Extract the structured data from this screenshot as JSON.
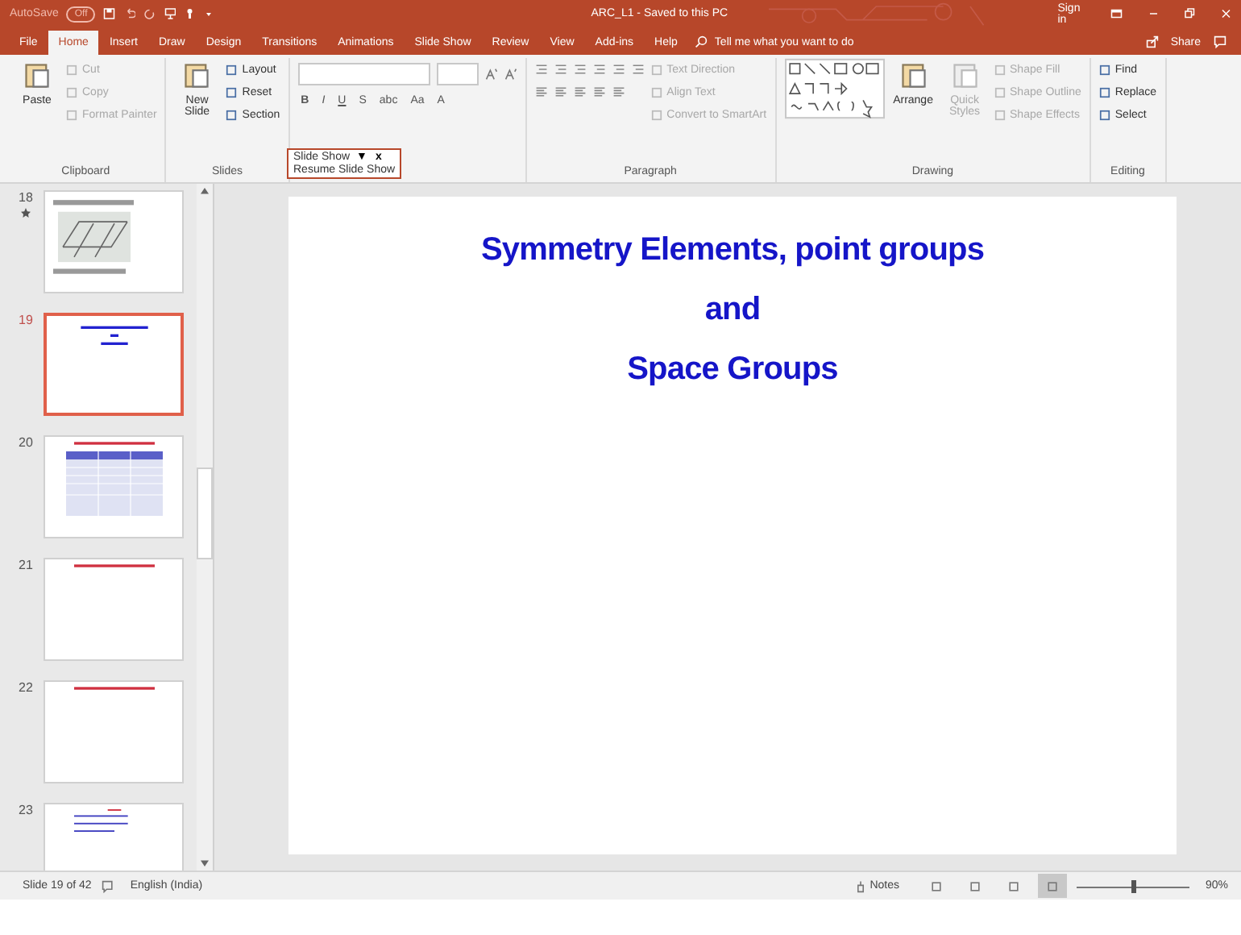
{
  "title_bar": {
    "autosave_label": "AutoSave",
    "autosave_state": "Off",
    "title": "ARC_L1  -  Saved to this PC",
    "sign_in": "Sign in"
  },
  "tabs": [
    {
      "label": "File",
      "selected": false
    },
    {
      "label": "Home",
      "selected": true
    },
    {
      "label": "Insert",
      "selected": false
    },
    {
      "label": "Draw",
      "selected": false
    },
    {
      "label": "Design",
      "selected": false
    },
    {
      "label": "Transitions",
      "selected": false
    },
    {
      "label": "Animations",
      "selected": false
    },
    {
      "label": "Slide Show",
      "selected": false
    },
    {
      "label": "Review",
      "selected": false
    },
    {
      "label": "View",
      "selected": false
    },
    {
      "label": "Add-ins",
      "selected": false
    },
    {
      "label": "Help",
      "selected": false
    }
  ],
  "tell_me": {
    "placeholder": "Tell me what you want to do"
  },
  "share": "Share",
  "ribbon": [
    {
      "kind": "commands",
      "label": "Clipboard",
      "large": [
        {
          "label": "Paste",
          "disabled": false
        }
      ],
      "small": [
        {
          "label": "Cut",
          "disabled": true
        },
        {
          "label": "Copy",
          "disabled": true
        },
        {
          "label": "Format Painter",
          "disabled": true
        }
      ]
    },
    {
      "kind": "commands",
      "label": "Slides",
      "large": [
        {
          "label": "New Slide",
          "disabled": false
        }
      ],
      "small": [
        {
          "label": "Layout",
          "disabled": false
        },
        {
          "label": "Reset",
          "disabled": false
        },
        {
          "label": "Section",
          "disabled": false
        }
      ]
    },
    {
      "kind": "font",
      "buttons": [
        "B",
        "I",
        "U",
        "S",
        "abc",
        "Aa",
        "A"
      ]
    },
    {
      "kind": "paragraph",
      "label": "Paragraph",
      "small": [
        {
          "label": "Text Direction",
          "disabled": true
        },
        {
          "label": "Align Text",
          "disabled": true
        },
        {
          "label": "Convert to SmartArt",
          "disabled": true
        }
      ]
    },
    {
      "kind": "drawing",
      "label": "Drawing",
      "large": [
        {
          "label": "Arrange",
          "disabled": false
        },
        {
          "label": "Quick Styles",
          "disabled": true
        }
      ],
      "small": [
        {
          "label": "Shape Fill",
          "disabled": true
        },
        {
          "label": "Shape Outline",
          "disabled": true
        },
        {
          "label": "Shape Effects",
          "disabled": true
        }
      ]
    },
    {
      "kind": "commands",
      "label": "Editing",
      "small": [
        {
          "label": "Find",
          "disabled": false
        },
        {
          "label": "Replace",
          "disabled": false
        },
        {
          "label": "Select",
          "disabled": false
        }
      ]
    }
  ],
  "popup": {
    "title": "Slide Show",
    "menu_glyph": "▼",
    "close_glyph": "x",
    "resume": "Resume Slide Show"
  },
  "thumbnails": [
    {
      "number": "18",
      "selected": false,
      "starred": true,
      "kind": "figure"
    },
    {
      "number": "19",
      "selected": true,
      "starred": false,
      "kind": "title"
    },
    {
      "number": "20",
      "selected": false,
      "starred": false,
      "kind": "table"
    },
    {
      "number": "21",
      "selected": false,
      "starred": false,
      "kind": "heading"
    },
    {
      "number": "22",
      "selected": false,
      "starred": false,
      "kind": "heading"
    },
    {
      "number": "23",
      "selected": false,
      "starred": false,
      "kind": "list"
    }
  ],
  "slide": {
    "lines": [
      "Symmetry Elements, point groups",
      "and",
      "Space Groups"
    ]
  },
  "status_bar": {
    "slide_info": "Slide 19 of 42",
    "language": "English (India)",
    "notes": "Notes",
    "views": [
      {
        "selected": false
      },
      {
        "selected": false
      },
      {
        "selected": false
      },
      {
        "selected": true
      }
    ],
    "zoom_slider": {
      "level": 0.5
    },
    "zoom": "90%"
  }
}
